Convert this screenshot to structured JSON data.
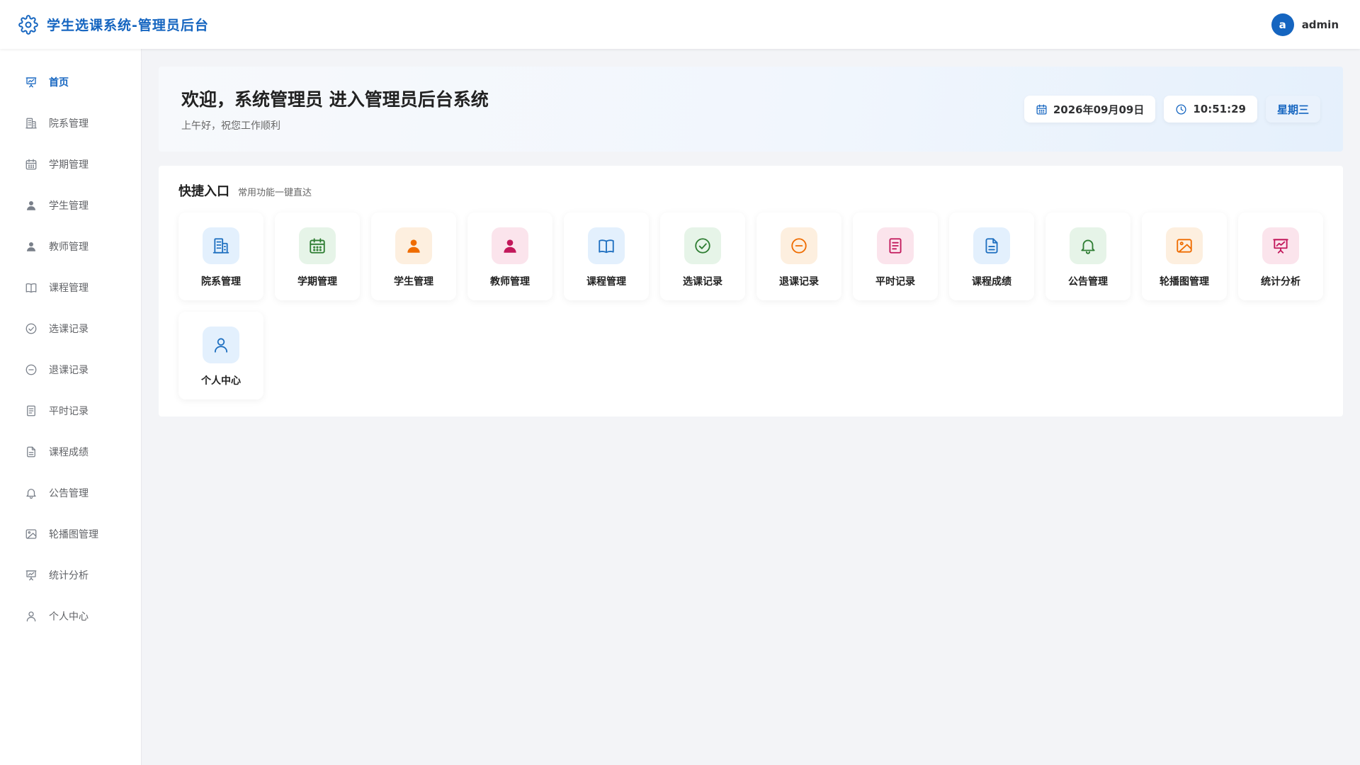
{
  "header": {
    "title": "学生选课系统-管理员后台",
    "logo_icon": "gear-icon"
  },
  "user": {
    "avatar_letter": "a",
    "name": "admin"
  },
  "sidebar": {
    "items": [
      {
        "label": "首页",
        "icon": "presentation-chart-icon",
        "active": true
      },
      {
        "label": "院系管理",
        "icon": "building-icon"
      },
      {
        "label": "学期管理",
        "icon": "calendar-icon"
      },
      {
        "label": "学生管理",
        "icon": "user-icon"
      },
      {
        "label": "教师管理",
        "icon": "user-icon"
      },
      {
        "label": "课程管理",
        "icon": "book-icon"
      },
      {
        "label": "选课记录",
        "icon": "check-circle-icon"
      },
      {
        "label": "退课记录",
        "icon": "minus-circle-icon"
      },
      {
        "label": "平时记录",
        "icon": "notes-icon"
      },
      {
        "label": "课程成绩",
        "icon": "document-icon"
      },
      {
        "label": "公告管理",
        "icon": "bell-icon"
      },
      {
        "label": "轮播图管理",
        "icon": "image-icon"
      },
      {
        "label": "统计分析",
        "icon": "presentation-chart-icon"
      },
      {
        "label": "个人中心",
        "icon": "user-outline-icon"
      }
    ]
  },
  "welcome": {
    "title": "欢迎，系统管理员 进入管理员后台系统",
    "subtitle": "上午好，祝您工作顺利",
    "date": "2026年09月09日",
    "time": "10:51:29",
    "weekday": "星期三"
  },
  "quick": {
    "title": "快捷入口",
    "subtitle": "常用功能一键直达",
    "items": [
      {
        "label": "院系管理",
        "icon": "building-icon",
        "tone": "blue"
      },
      {
        "label": "学期管理",
        "icon": "calendar-icon",
        "tone": "green"
      },
      {
        "label": "学生管理",
        "icon": "user-icon",
        "tone": "orange"
      },
      {
        "label": "教师管理",
        "icon": "user-icon",
        "tone": "pink"
      },
      {
        "label": "课程管理",
        "icon": "book-icon",
        "tone": "blue"
      },
      {
        "label": "选课记录",
        "icon": "check-circle-icon",
        "tone": "green"
      },
      {
        "label": "退课记录",
        "icon": "minus-circle-icon",
        "tone": "orange"
      },
      {
        "label": "平时记录",
        "icon": "notes-icon",
        "tone": "pink"
      },
      {
        "label": "课程成绩",
        "icon": "document-icon",
        "tone": "blue"
      },
      {
        "label": "公告管理",
        "icon": "bell-icon",
        "tone": "green"
      },
      {
        "label": "轮播图管理",
        "icon": "image-icon",
        "tone": "orange"
      },
      {
        "label": "统计分析",
        "icon": "presentation-chart-icon",
        "tone": "pink"
      },
      {
        "label": "个人中心",
        "icon": "user-outline-icon",
        "tone": "blue"
      }
    ]
  },
  "colors": {
    "primary": "#1565c0",
    "sidebar_icon": "#7a808a",
    "blue_bg": "#e3f0fd",
    "blue_fg": "#1e6fc0",
    "green_bg": "#e6f4e8",
    "green_fg": "#2e7d32",
    "orange_bg": "#fdefdf",
    "orange_fg": "#ef6c00",
    "pink_bg": "#fbe4ec",
    "pink_fg": "#c2185b"
  }
}
